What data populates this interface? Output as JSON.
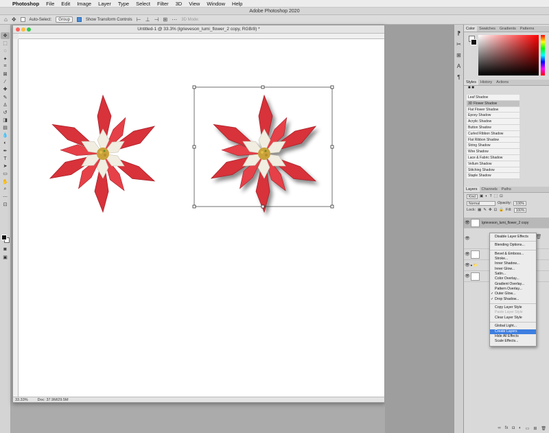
{
  "menubar": {
    "items": [
      "Photoshop",
      "File",
      "Edit",
      "Image",
      "Layer",
      "Type",
      "Select",
      "Filter",
      "3D",
      "View",
      "Window",
      "Help"
    ]
  },
  "app_title": "Adobe Photoshop 2020",
  "options_bar": {
    "auto_select_label": "Auto-Select:",
    "auto_select_value": "Group",
    "show_transform_label": "Show Transform Controls",
    "mode_label": "3D Mode:"
  },
  "document": {
    "title": "Untitled-1 @ 33.3% (lgrieveson_lumi_flower_2 copy, RGB/8) *",
    "zoom": "33.33%",
    "doc_size": "Doc: 37.9M/29.5M"
  },
  "color_panel": {
    "tabs": [
      "Color",
      "Swatches",
      "Gradients",
      "Patterns"
    ]
  },
  "styles_panel": {
    "tabs": [
      "Styles",
      "History",
      "Actions"
    ],
    "items": [
      "Leaf Shadow",
      "3D Flower Shadow",
      "Flat Flower Shadow",
      "Epoxy Shadow",
      "Acrylic Shadow",
      "Button Shadow",
      "Curled Ribbon Shadow",
      "Flat Ribbon Shadow",
      "String Shadow",
      "Wire Shadow",
      "Lace & Fabric Shadow",
      "Vellum Shadow",
      "Stitching Shadow",
      "Staple Shadow"
    ]
  },
  "layers_panel": {
    "tabs": [
      "Layers",
      "Channels",
      "Paths"
    ],
    "kind_label": "Kind",
    "blend_mode": "Normal",
    "opacity_label": "Opacity:",
    "opacity_value": "100%",
    "lock_label": "Lock:",
    "fill_label": "Fill:",
    "fill_value": "100%",
    "layer_name": "lgrieveson_lumi_flower_2 copy"
  },
  "context_menu": {
    "items": [
      {
        "label": "Disable Layer Effects",
        "state": "normal"
      },
      {
        "sep": true
      },
      {
        "label": "Blending Options...",
        "state": "normal"
      },
      {
        "sep": true
      },
      {
        "label": "Bevel & Emboss...",
        "state": "normal"
      },
      {
        "label": "Stroke...",
        "state": "normal"
      },
      {
        "label": "Inner Shadow...",
        "state": "normal"
      },
      {
        "label": "Inner Glow...",
        "state": "normal"
      },
      {
        "label": "Satin...",
        "state": "normal"
      },
      {
        "label": "Color Overlay...",
        "state": "normal"
      },
      {
        "label": "Gradient Overlay...",
        "state": "normal"
      },
      {
        "label": "Pattern Overlay...",
        "state": "normal"
      },
      {
        "label": "Outer Glow...",
        "state": "checked"
      },
      {
        "label": "Drop Shadow...",
        "state": "checked"
      },
      {
        "sep": true
      },
      {
        "label": "Copy Layer Style",
        "state": "normal"
      },
      {
        "label": "Paste Layer Style",
        "state": "disabled"
      },
      {
        "label": "Clear Layer Style",
        "state": "normal"
      },
      {
        "sep": true
      },
      {
        "label": "Global Light...",
        "state": "normal"
      },
      {
        "label": "Create Layers",
        "state": "highlighted"
      },
      {
        "label": "Hide All Effects",
        "state": "normal"
      },
      {
        "label": "Scale Effects...",
        "state": "normal"
      }
    ]
  },
  "colors": {
    "petal_red": "#d8323a",
    "petal_white": "#f1ede1",
    "menu_highlight": "#3d7ee0"
  }
}
